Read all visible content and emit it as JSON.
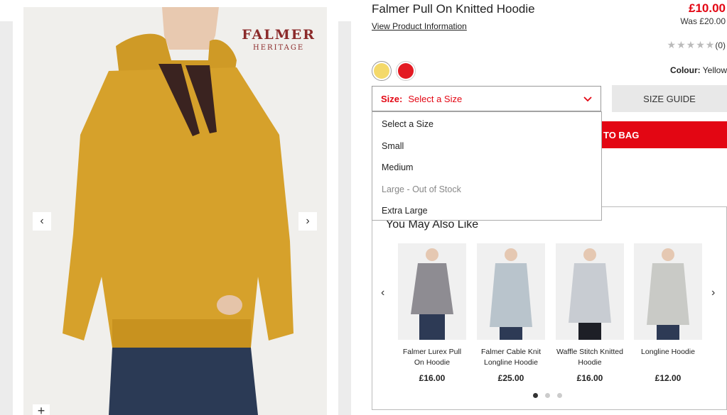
{
  "product": {
    "title": "Falmer Pull On Knitted Hoodie",
    "view_info": "View Product Information",
    "price": "£10.00",
    "was_price": "Was £20.00",
    "rating_count": "(0)",
    "rating_value": 0,
    "colour_label": "Colour:",
    "colour_value": "Yellow"
  },
  "brand_logo": {
    "line1": "FALMER",
    "line2": "HERITAGE"
  },
  "swatches": [
    {
      "name": "yellow",
      "color": "#f4d96a",
      "selected": true
    },
    {
      "name": "red",
      "color": "#e31b23",
      "selected": false
    }
  ],
  "size": {
    "label": "Size:",
    "value": "Select a Size",
    "guide": "SIZE GUIDE",
    "options": [
      "Select a Size",
      "Small",
      "Medium",
      "Large - Out of Stock",
      "Extra Large"
    ]
  },
  "add_to_bag": "TO BAG",
  "ymal": {
    "title": "You May Also Like",
    "products": [
      {
        "name": "Falmer Lurex Pull On Hoodie",
        "price": "£16.00",
        "color": "#8e8c92"
      },
      {
        "name": "Falmer Cable Knit Longline Hoodie",
        "price": "£25.00",
        "color": "#b9c4cc"
      },
      {
        "name": "Waffle Stitch Knitted Hoodie",
        "price": "£16.00",
        "color": "#c8ccd2"
      },
      {
        "name": "Longline Hoodie",
        "price": "£12.00",
        "color": "#c9cac6"
      }
    ]
  },
  "icons": {
    "gallery_prev": "‹",
    "gallery_next": "›",
    "zoom": "+",
    "chevron": "⌄",
    "star": "★"
  },
  "colors": {
    "accent": "#e30613",
    "sweater": "#d9a52b"
  }
}
